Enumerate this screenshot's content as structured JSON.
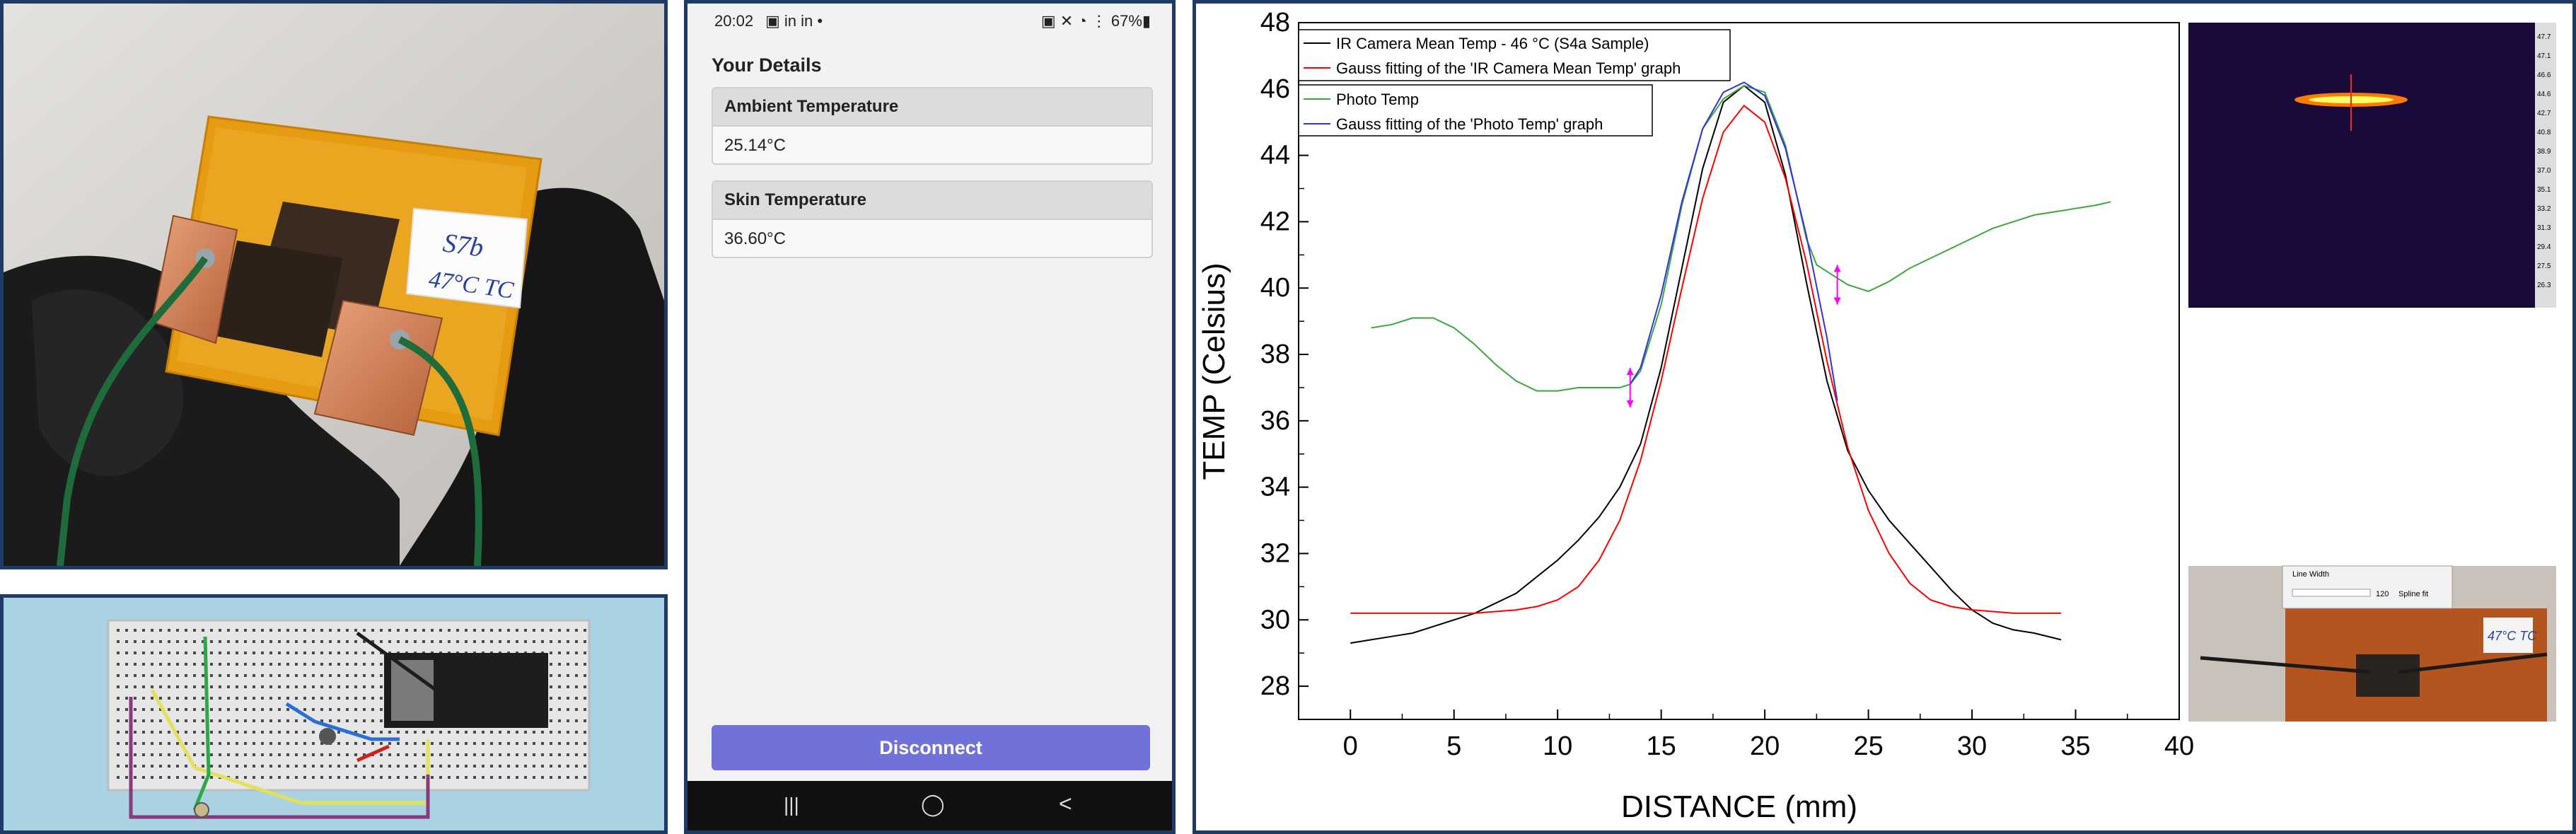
{
  "phone": {
    "status": {
      "time": "20:02",
      "apps": "▣ in in •",
      "right": "▣ ✕ ◔ ⋮ 67%▮"
    },
    "title": "Your Details",
    "fields": [
      {
        "label": "Ambient Temperature",
        "value": "25.14°C"
      },
      {
        "label": "Skin Temperature",
        "value": "36.60°C"
      }
    ],
    "disconnect_label": "Disconnect",
    "nav": {
      "recent": "|||",
      "home": "◯",
      "back": "<"
    }
  },
  "photo": {
    "label_line1": "S7b",
    "label_line2": "47°C TC"
  },
  "inset": {
    "label": "47°C TC",
    "window_title": "Line Width",
    "line_width_value": "120",
    "spline_label": "Spline fit"
  },
  "thermal": {
    "scale_values": [
      "47.7",
      "47.1",
      "46.6",
      "44.6",
      "42.7",
      "40.8",
      "38.9",
      "37.0",
      "35.1",
      "33.2",
      "31.3",
      "29.4",
      "27.5",
      "26.3"
    ]
  },
  "colors": {
    "ir": "#000000",
    "ir_fit": "#ff0000",
    "photo": "#3aa93a",
    "photo_fit": "#3333dd",
    "marker": "#ff00ff"
  },
  "chart_data": {
    "type": "line",
    "xlabel": "DISTANCE (mm)",
    "ylabel": "TEMP (Celsius)",
    "xlim": [
      -2.5,
      40
    ],
    "ylim": [
      27,
      48
    ],
    "xticks": [
      0,
      5,
      10,
      15,
      20,
      25,
      30,
      35,
      40
    ],
    "yticks": [
      28,
      30,
      32,
      34,
      36,
      38,
      40,
      42,
      44,
      46,
      48
    ],
    "legend_top": [
      "IR Camera Mean Temp - 46 °C (S4a Sample)",
      "Gauss fitting of the 'IR Camera Mean Temp' graph"
    ],
    "legend_bottom": [
      "Photo Temp",
      "Gauss fitting of the 'Photo Temp' graph"
    ],
    "series": [
      {
        "name": "IR Camera Mean Temp - 46 °C (S4a Sample)",
        "x": [
          0,
          1,
          2,
          3,
          4,
          5,
          6,
          7,
          8,
          9,
          10,
          11,
          12,
          13,
          14,
          15,
          16,
          17,
          18,
          19,
          20,
          21,
          22,
          23,
          24,
          25,
          26,
          27,
          28,
          29,
          30,
          31,
          32,
          33,
          34.3
        ],
        "y": [
          29.3,
          29.4,
          29.5,
          29.6,
          29.8,
          30.0,
          30.2,
          30.5,
          30.8,
          31.3,
          31.8,
          32.4,
          33.1,
          34.0,
          35.3,
          37.6,
          40.6,
          43.6,
          45.6,
          46.1,
          45.6,
          43.4,
          40.2,
          37.2,
          35.1,
          33.9,
          33.0,
          32.3,
          31.6,
          30.9,
          30.3,
          29.9,
          29.7,
          29.6,
          29.4
        ]
      },
      {
        "name": "Gauss fitting of the 'IR Camera Mean Temp' graph",
        "x": [
          0,
          2,
          4,
          6,
          8,
          9,
          10,
          11,
          12,
          13,
          14,
          15,
          16,
          17,
          18,
          19,
          20,
          21,
          22,
          23,
          24,
          25,
          26,
          27,
          28,
          29,
          30,
          32,
          34.3
        ],
        "y": [
          30.2,
          30.2,
          30.2,
          30.2,
          30.3,
          30.4,
          30.6,
          31.0,
          31.8,
          33.0,
          34.8,
          37.2,
          40.0,
          42.7,
          44.7,
          45.5,
          45.0,
          43.3,
          40.8,
          37.8,
          35.2,
          33.3,
          32.0,
          31.1,
          30.6,
          30.4,
          30.3,
          30.2,
          30.2
        ]
      },
      {
        "name": "Photo Temp",
        "x": [
          1,
          2,
          3,
          4,
          5,
          6,
          7,
          8,
          9,
          10,
          11,
          12,
          13,
          13.5,
          14,
          15,
          16,
          17,
          18,
          19,
          20,
          21,
          22,
          22.5,
          23,
          24,
          25,
          26,
          27,
          28,
          29,
          30,
          31,
          32,
          33,
          34,
          35,
          36,
          36.7
        ],
        "y": [
          38.8,
          38.9,
          39.1,
          39.1,
          38.8,
          38.3,
          37.7,
          37.2,
          36.9,
          36.9,
          37.0,
          37.0,
          37.0,
          37.1,
          37.5,
          39.5,
          42.5,
          44.8,
          45.7,
          46.1,
          45.9,
          44.3,
          41.5,
          40.7,
          40.5,
          40.1,
          39.9,
          40.2,
          40.6,
          40.9,
          41.2,
          41.5,
          41.8,
          42.0,
          42.2,
          42.3,
          42.4,
          42.5,
          42.6
        ]
      },
      {
        "name": "Gauss fitting of the 'Photo Temp' graph",
        "x": [
          13.5,
          14,
          15,
          16,
          17,
          18,
          19,
          20,
          21,
          22,
          23,
          23.5
        ],
        "y": [
          37.1,
          37.6,
          39.8,
          42.6,
          44.8,
          45.9,
          46.2,
          45.8,
          44.2,
          41.6,
          38.5,
          36.6
        ]
      }
    ]
  }
}
